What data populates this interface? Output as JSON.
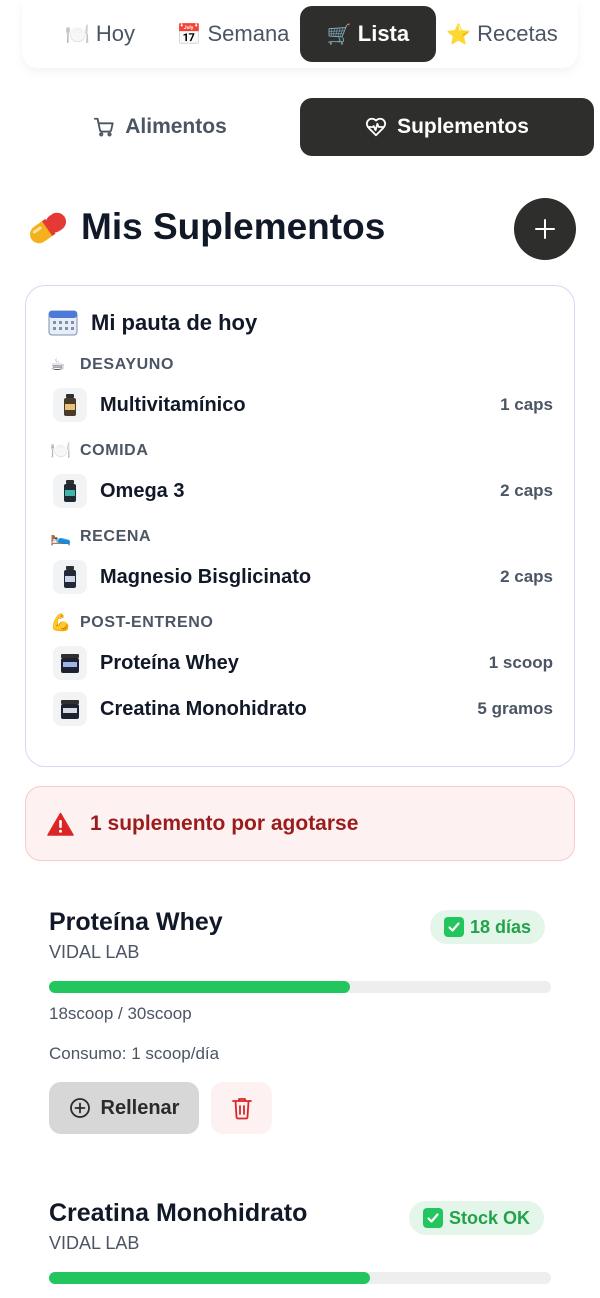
{
  "nav": {
    "tabs": [
      {
        "icon": "🍽️",
        "label": "Hoy"
      },
      {
        "icon": "📅",
        "label": "Semana"
      },
      {
        "icon": "🛒",
        "label": "Lista"
      },
      {
        "icon": "⭐",
        "label": "Recetas"
      }
    ],
    "active": "Lista"
  },
  "segments": {
    "alimentos": "Alimentos",
    "suplementos": "Suplementos",
    "active": "Suplementos"
  },
  "header": {
    "title": "Mis Suplementos",
    "add_icon": "plus-icon"
  },
  "plan": {
    "title": "Mi pauta de hoy",
    "groups": [
      {
        "icon": "☕",
        "label": "DESAYUNO",
        "items": [
          {
            "name": "Multivitamínico",
            "dose": "1 caps"
          }
        ]
      },
      {
        "icon": "🍽️",
        "label": "COMIDA",
        "items": [
          {
            "name": "Omega 3",
            "dose": "2 caps"
          }
        ]
      },
      {
        "icon": "🛌",
        "label": "RECENA",
        "items": [
          {
            "name": "Magnesio Bisglicinato",
            "dose": "2 caps"
          }
        ]
      },
      {
        "icon": "💪",
        "label": "POST-ENTRENO",
        "items": [
          {
            "name": "Proteína Whey",
            "dose": "1 scoop"
          },
          {
            "name": "Creatina Monohidrato",
            "dose": "5 gramos"
          }
        ]
      }
    ]
  },
  "alert": {
    "text": "1 suplemento por agotarse",
    "color": "#9b1c1c"
  },
  "inventory": [
    {
      "name": "Proteína Whey",
      "brand": "VIDAL LAB",
      "badge": "18 días",
      "stock_fraction": 0.6,
      "stock_text": "18scoop / 30scoop",
      "consumption": "Consumo: 1 scoop/día",
      "refill_label": "Rellenar"
    },
    {
      "name": "Creatina Monohidrato",
      "brand": "VIDAL LAB",
      "badge": "Stock OK",
      "stock_fraction": 0.64
    }
  ],
  "colors": {
    "accent_dark": "#2e2e2c",
    "success": "#22c55e",
    "danger": "#dc2626"
  }
}
